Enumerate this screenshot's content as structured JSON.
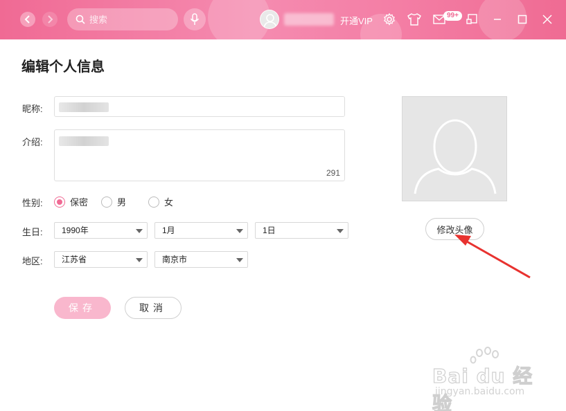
{
  "titlebar": {
    "search_placeholder": "搜索",
    "vip_label": "开通VIP",
    "mail_badge": "99+"
  },
  "page": {
    "title": "编辑个人信息"
  },
  "form": {
    "nickname_label": "昵称:",
    "intro_label": "介绍:",
    "intro_counter": "291",
    "gender_label": "性别:",
    "gender_options": [
      "保密",
      "男",
      "女"
    ],
    "gender_selected": "保密",
    "birthday_label": "生日:",
    "birthday_year": "1990年",
    "birthday_month": "1月",
    "birthday_day": "1日",
    "region_label": "地区:",
    "region_province": "江苏省",
    "region_city": "南京市",
    "save_label": "保存",
    "cancel_label": "取消"
  },
  "avatar": {
    "change_label": "修改头像"
  },
  "watermark": {
    "brand": "Bai du 经验",
    "url": "jingyan.baidu.com"
  },
  "colors": {
    "brand_pink": "#f06a94",
    "save_button": "#f9b7cd",
    "arrow_red": "#e8322f"
  }
}
